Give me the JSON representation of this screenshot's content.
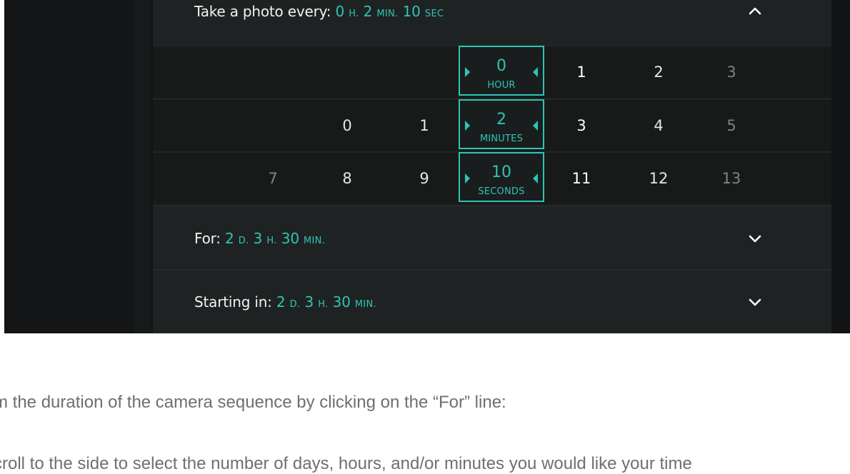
{
  "take_photo": {
    "label": "Take a photo every:",
    "hours_value": "0",
    "hours_unit": "H.",
    "minutes_value": "2",
    "minutes_unit": "MIN.",
    "seconds_value": "10",
    "seconds_unit": "SEC"
  },
  "picker": {
    "hours": {
      "before": [],
      "selected": "0",
      "unit": "HOUR",
      "after": [
        "1",
        "2",
        "3"
      ]
    },
    "minutes": {
      "before": [
        "0",
        "1"
      ],
      "selected": "2",
      "unit": "MINUTES",
      "after": [
        "3",
        "4",
        "5"
      ]
    },
    "seconds": {
      "before": [
        "7",
        "8",
        "9"
      ],
      "selected": "10",
      "unit": "SECONDS",
      "after": [
        "11",
        "12",
        "13"
      ]
    }
  },
  "for_row": {
    "label": "For:",
    "days_value": "2",
    "days_unit": "D.",
    "hours_value": "3",
    "hours_unit": "H.",
    "minutes_value": "30",
    "minutes_unit": "MIN."
  },
  "starting_row": {
    "label": "Starting in:",
    "days_value": "2",
    "days_unit": "D.",
    "hours_value": "3",
    "hours_unit": "H.",
    "minutes_value": "30",
    "minutes_unit": "MIN."
  },
  "doc": {
    "line1": "m the duration of the camera sequence by clicking on the “For” line:",
    "line2": "croll to the side to select the number of days, hours, and/or minutes you would like your time"
  },
  "colors": {
    "accent": "#2ec4b6",
    "panel": "#1f2222",
    "picker_row": "#181a1a",
    "background": "#121314"
  },
  "icons": {
    "collapse": "chevron-up-icon",
    "expand": "chevron-down-icon",
    "spinner": "caret-arrows-icon"
  }
}
